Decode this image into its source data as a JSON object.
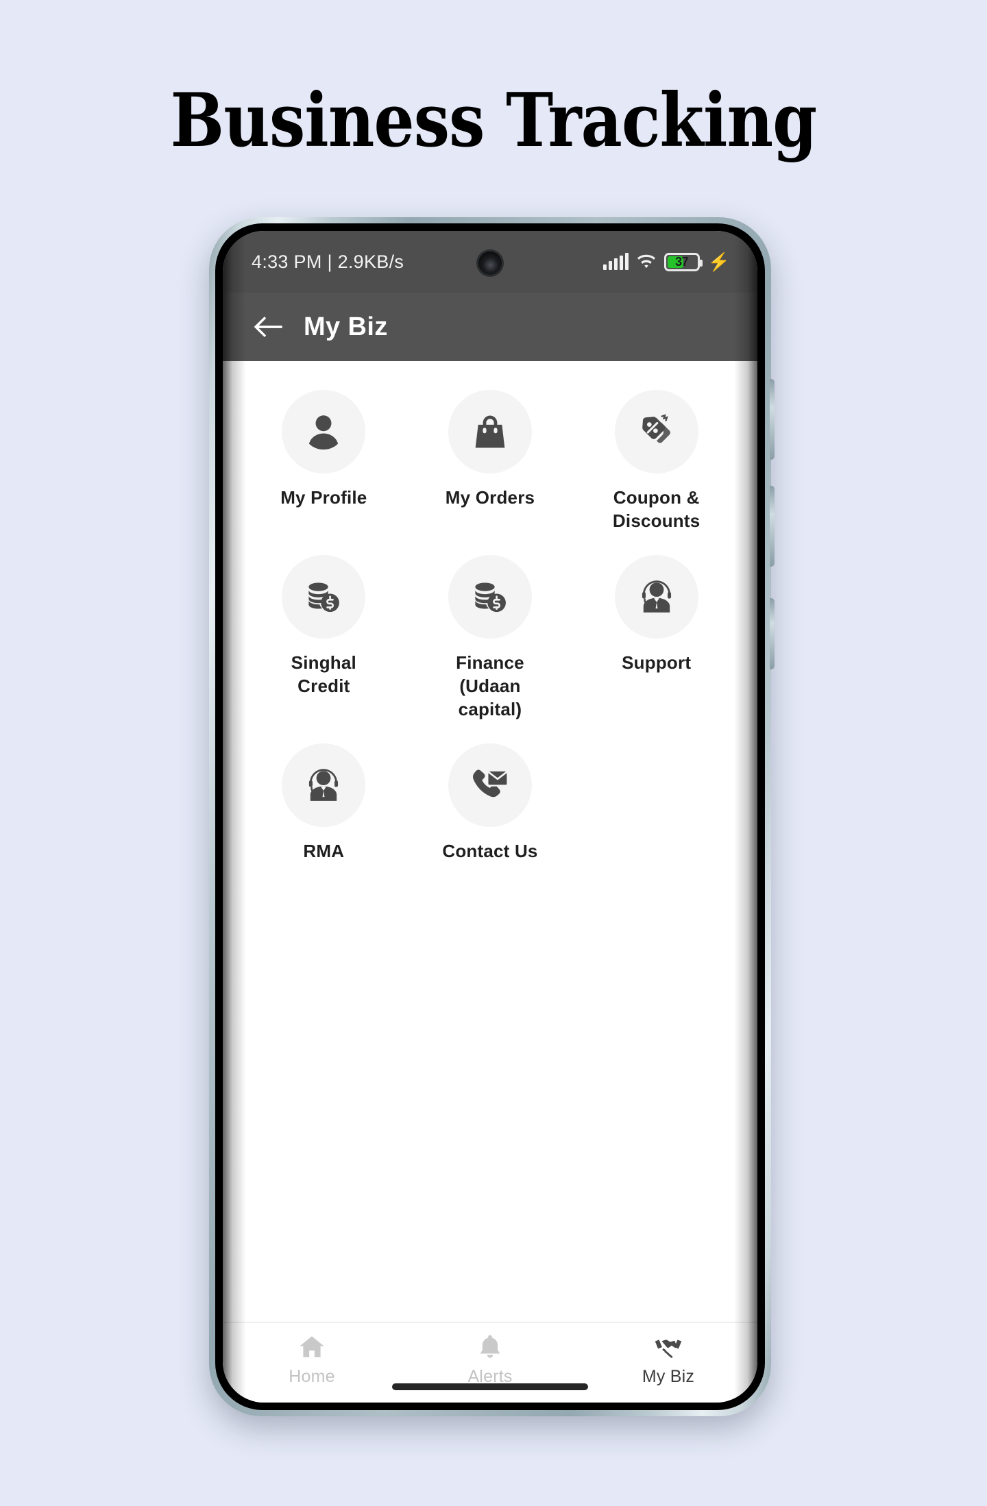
{
  "poster": {
    "headline": "Business Tracking",
    "background_color": "#e4e8f7"
  },
  "phone": {
    "statusbar": {
      "time_and_network": "4:33 PM | 2.9KB/s",
      "signal_icon": "signal-bars-icon",
      "wifi_icon": "wifi-icon",
      "battery_percent": "37",
      "battery_level": 37,
      "battery_color": "#25c229",
      "charging_icon": "charging-bolt-icon",
      "camera_icon": "front-camera-punch-hole"
    },
    "appbar": {
      "back_icon": "back-arrow-icon",
      "title": "My Biz",
      "background_color": "#535353"
    },
    "grid": {
      "tiles": [
        {
          "label": "My Profile",
          "icon": "person-icon"
        },
        {
          "label": "My Orders",
          "icon": "shopping-bag-icon"
        },
        {
          "label": "Coupon &\nDiscounts",
          "icon": "discount-tag-icon"
        },
        {
          "label": "Singhal\nCredit",
          "icon": "coin-stack-dollar-icon"
        },
        {
          "label": "Finance\n(Udaan\ncapital)",
          "icon": "coin-stack-dollar-icon"
        },
        {
          "label": "Support",
          "icon": "headset-agent-icon"
        },
        {
          "label": "RMA",
          "icon": "headset-agent-icon"
        },
        {
          "label": "Contact Us",
          "icon": "phone-envelope-icon"
        }
      ]
    },
    "bottomnav": {
      "items": [
        {
          "label": "Home",
          "icon": "home-icon",
          "active": false
        },
        {
          "label": "Alerts",
          "icon": "bell-icon",
          "active": false
        },
        {
          "label": "My Biz",
          "icon": "handshake-icon",
          "active": true
        }
      ]
    }
  }
}
